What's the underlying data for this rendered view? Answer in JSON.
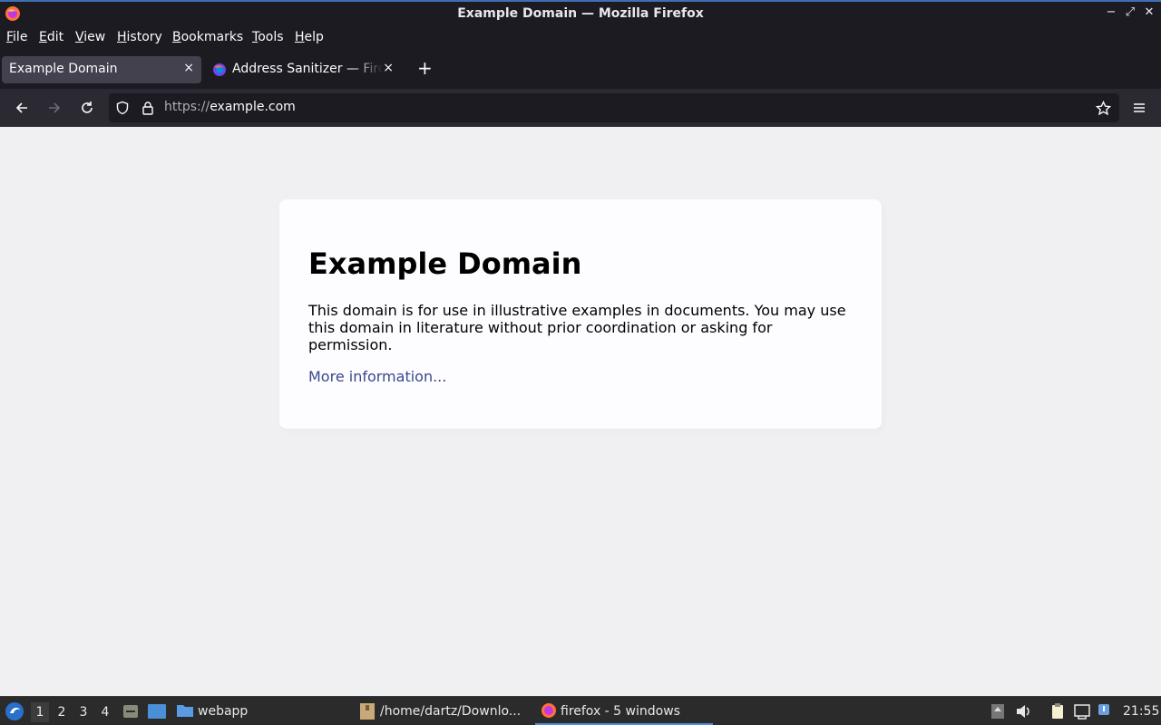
{
  "window": {
    "title": "Example Domain — Mozilla Firefox",
    "controls": {
      "minimize": "−",
      "maximize": "⤢",
      "close": "✕"
    }
  },
  "menu": [
    "File",
    "Edit",
    "View",
    "History",
    "Bookmarks",
    "Tools",
    "Help"
  ],
  "menu_first": [
    "F",
    "E",
    "V",
    "H",
    "B",
    "T",
    "H"
  ],
  "menu_rest": [
    "ile",
    "dit",
    "iew",
    "istory",
    "ookmarks",
    "ools",
    "elp"
  ],
  "tabs": [
    {
      "label": "Example Domain",
      "active": true
    },
    {
      "label": "Address Sanitizer — Firefox",
      "active": false
    }
  ],
  "tab_close": "×",
  "new_tab": "+",
  "urlbar": {
    "protocol": "https://",
    "host": "example.com"
  },
  "page": {
    "heading": "Example Domain",
    "paragraph": "This domain is for use in illustrative examples in documents. You may use this domain in literature without prior coordination or asking for permission.",
    "link": "More information..."
  },
  "taskbar": {
    "workspaces": [
      "1",
      "2",
      "3",
      "4"
    ],
    "active_workspace": "1",
    "tasks": [
      {
        "label": "webapp",
        "icon": "folder-icon"
      },
      {
        "label": "/home/dartz/Downlo...",
        "icon": "archive-icon"
      },
      {
        "label": "firefox - 5 windows",
        "icon": "firefox-icon",
        "active": true
      }
    ],
    "clock": "21:55"
  },
  "colors": {
    "accent": "#4a90d9",
    "link": "#38488f",
    "page_bg": "#f0f0f2"
  }
}
